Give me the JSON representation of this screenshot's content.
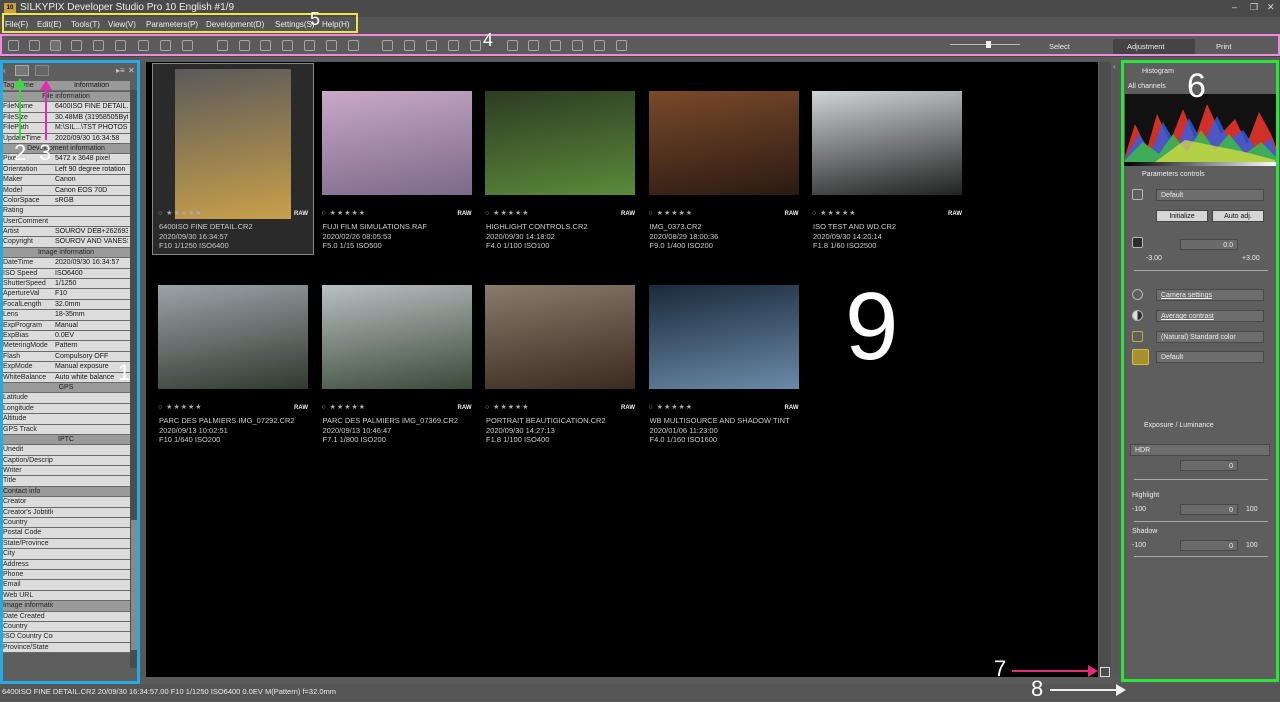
{
  "window": {
    "title": "SILKYPIX Developer Studio Pro 10 English   #1/9",
    "app_icon_text": "10",
    "controls": [
      "–",
      "❐",
      "✕"
    ]
  },
  "menu": [
    "File(F)",
    "Edit(E)",
    "Tools(T)",
    "View(V)",
    "Parameters(P)",
    "Development(D)",
    "Settings(S)",
    "Help(H)"
  ],
  "view_tabs": {
    "select": "Select",
    "adjustment": "Adjustment",
    "print": "Print"
  },
  "left_panel": {
    "header": {
      "tag": "Tag name",
      "info": "Information"
    },
    "rows": [
      {
        "t": "sec",
        "k": "File information"
      },
      {
        "t": "row",
        "k": "FileName",
        "v": "6400ISO FINE DETAIL.CR2"
      },
      {
        "t": "row",
        "k": "FileSize",
        "v": "30.48MB (31958505Byte)"
      },
      {
        "t": "row",
        "k": "FilePath",
        "v": "M:\\SIL...\\TST PHOTOS"
      },
      {
        "t": "row",
        "k": "UpdateTime",
        "v": "2020/09/30 16:34:58"
      },
      {
        "t": "sec",
        "k": "Development information"
      },
      {
        "t": "row",
        "k": "Pixel",
        "v": "5472 x 3648 pixel"
      },
      {
        "t": "row",
        "k": "Orientation",
        "v": "Left 90 degree rotation"
      },
      {
        "t": "row",
        "k": "Maker",
        "v": "Canon"
      },
      {
        "t": "row",
        "k": "Model",
        "v": "Canon EOS 70D"
      },
      {
        "t": "row",
        "k": "ColorSpace",
        "v": "sRGB"
      },
      {
        "t": "row",
        "k": "Rating",
        "v": ""
      },
      {
        "t": "row",
        "k": "UserComment",
        "v": ""
      },
      {
        "t": "row",
        "k": "Artist",
        "v": "SOUROV DEB+262693"
      },
      {
        "t": "row",
        "k": "Copyright",
        "v": "SOUROV AND VANESSA"
      },
      {
        "t": "sec",
        "k": "Image information"
      },
      {
        "t": "row",
        "k": "DateTime",
        "v": "2020/09/30 16:34:57"
      },
      {
        "t": "row",
        "k": "ISO Speed",
        "v": "ISO6400"
      },
      {
        "t": "row",
        "k": "ShutterSpeed",
        "v": "1/1250"
      },
      {
        "t": "row",
        "k": "ApertureVal",
        "v": "F10"
      },
      {
        "t": "row",
        "k": "FocalLength",
        "v": "32.0mm"
      },
      {
        "t": "row",
        "k": "Lens",
        "v": "18-35mm"
      },
      {
        "t": "row",
        "k": "ExpProgram",
        "v": "Manual"
      },
      {
        "t": "row",
        "k": "ExpBias",
        "v": "0.0EV"
      },
      {
        "t": "row",
        "k": "MeteringMode",
        "v": "Pattern"
      },
      {
        "t": "row",
        "k": "Flash",
        "v": "Compulsory OFF"
      },
      {
        "t": "row",
        "k": "ExpMode",
        "v": "Manual exposure"
      },
      {
        "t": "row",
        "k": "WhiteBalance",
        "v": "Auto white balance"
      },
      {
        "t": "sec",
        "k": "GPS"
      },
      {
        "t": "row",
        "k": "Latitude",
        "v": ""
      },
      {
        "t": "row",
        "k": "Longitude",
        "v": ""
      },
      {
        "t": "row",
        "k": "Altitude",
        "v": ""
      },
      {
        "t": "row",
        "k": "GPS Track",
        "v": ""
      },
      {
        "t": "sec",
        "k": "IPTC"
      },
      {
        "t": "row",
        "k": "Unedit",
        "v": ""
      },
      {
        "t": "row",
        "k": "Caption/Description",
        "v": ""
      },
      {
        "t": "row",
        "k": "Writer",
        "v": ""
      },
      {
        "t": "row",
        "k": "Title",
        "v": ""
      },
      {
        "t": "head",
        "k": "Contact info"
      },
      {
        "t": "row",
        "k": "Creator",
        "v": ""
      },
      {
        "t": "row",
        "k": "Creator's Jobtitle",
        "v": ""
      },
      {
        "t": "row",
        "k": "Country",
        "v": ""
      },
      {
        "t": "row",
        "k": "Postal Code",
        "v": ""
      },
      {
        "t": "row",
        "k": "State/Province",
        "v": ""
      },
      {
        "t": "row",
        "k": "City",
        "v": ""
      },
      {
        "t": "row",
        "k": "Address",
        "v": ""
      },
      {
        "t": "row",
        "k": "Phone",
        "v": ""
      },
      {
        "t": "row",
        "k": "Email",
        "v": ""
      },
      {
        "t": "row",
        "k": "Web URL",
        "v": ""
      },
      {
        "t": "head",
        "k": "Image information"
      },
      {
        "t": "row",
        "k": "Date Created",
        "v": ""
      },
      {
        "t": "row",
        "k": "Country",
        "v": ""
      },
      {
        "t": "row",
        "k": "ISO Country Code",
        "v": ""
      },
      {
        "t": "row",
        "k": "Province/State",
        "v": ""
      }
    ]
  },
  "thumbnails": [
    {
      "name": "6400ISO FINE DETAIL.CR2",
      "date": "2020/09/30 16:34:57",
      "exif": "F10 1/1250 ISO6400",
      "colors": [
        "#5a5a5a",
        "#c9a04a"
      ]
    },
    {
      "name": "FUJI FILM SIMULATIONS.RAF",
      "date": "2020/02/26 08:05:53",
      "exif": "F5.0 1/15 ISO500",
      "colors": [
        "#c9a8c8",
        "#7a6a88"
      ]
    },
    {
      "name": "HIGHLIGHT CONTROLS.CR2",
      "date": "2020/09/30 14:18:02",
      "exif": "F4.0 1/100 ISO100",
      "colors": [
        "#2e3b23",
        "#5a8a3a"
      ]
    },
    {
      "name": "IMG_0373.CR2",
      "date": "2020/08/29 18:00:36",
      "exif": "F9.0 1/400 ISO200",
      "colors": [
        "#7a4a2a",
        "#2a1a12"
      ]
    },
    {
      "name": "ISO TEST AND WD.CR2",
      "date": "2020/09/30 14:20:14",
      "exif": "F1.8 1/60 ISO2500",
      "colors": [
        "#cfd4d6",
        "#222"
      ]
    },
    {
      "name": "PARC DES PALMIERS IMG_07292.CR2",
      "date": "2020/09/13 10:02:51",
      "exif": "F10 1/640 ISO200",
      "colors": [
        "#9aa3a8",
        "#2f3a2f"
      ]
    },
    {
      "name": "PARC DES PALMIERS IMG_07369.CR2",
      "date": "2020/09/13 10:46:47",
      "exif": "F7.1 1/800 ISO200",
      "colors": [
        "#b8bfc2",
        "#3a4a38"
      ]
    },
    {
      "name": "PORTRAIT BEAUTIGICATION.CR2",
      "date": "2020/09/30 14:27:13",
      "exif": "F1.8 1/100 ISO400",
      "colors": [
        "#8a7a6a",
        "#3a2a20"
      ]
    },
    {
      "name": "WB MULTISOURCE AND SHADOW TINT",
      "date": "2020/01/06 11:23:00",
      "exif": "F4.0 1/160 ISO1600",
      "colors": [
        "#1a2a3a",
        "#6a8aa8"
      ]
    }
  ],
  "right_panel": {
    "histogram": {
      "title": "Histogram",
      "channel": "All channels"
    },
    "params": {
      "title": "Parameters controls",
      "preset": "Default",
      "initialize": "Initialize",
      "auto_adj": "Auto adj.",
      "exposure_value": "0.0",
      "exposure_min": "-3.00",
      "exposure_max": "+3.00",
      "wb": "Camera settings",
      "contrast": "Average contrast",
      "color": "(Natural) Standard color",
      "sharp": "Default"
    },
    "exposure": {
      "title": "Exposure / Luminance",
      "hdr": "HDR",
      "hdr_value": "0",
      "highlight": "Highlight",
      "highlight_value": "0",
      "shadow": "Shadow",
      "shadow_value": "0",
      "min": "-100",
      "max": "100"
    }
  },
  "annotations": {
    "n1": "1",
    "n2": "2",
    "n3": "3",
    "n4": "4",
    "n5": "5",
    "n6": "6",
    "n7": "7",
    "n8": "8",
    "n9": "9"
  },
  "status": "6400ISO FINE DETAIL.CR2 20/09/30 16:34:57.00 F10 1/1250 ISO6400  0.0EV M(Pattern) f=32.0mm",
  "colors": {
    "left_highlight": "#27a9e6",
    "menu_highlight": "#f2e34a",
    "toolbar_highlight": "#ee8be0",
    "right_highlight": "#2be33b"
  }
}
